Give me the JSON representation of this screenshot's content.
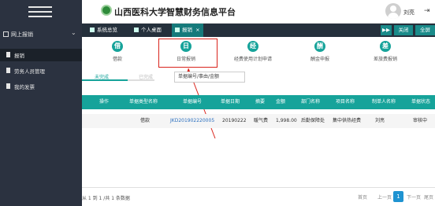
{
  "header": {
    "title": "山西医科大学智慧财务信息平台",
    "username": "刘亮",
    "logout_glyph": "⇥"
  },
  "sidebar": {
    "group_label": "网上报销",
    "items": [
      {
        "label": "报销",
        "active": true
      },
      {
        "label": "劳务人员管理",
        "active": false
      },
      {
        "label": "我的发票",
        "active": false
      }
    ]
  },
  "tabbar": {
    "tabs": [
      {
        "label": "系统总览",
        "active": false
      },
      {
        "label": "个人桌面",
        "active": false
      },
      {
        "label": "报销",
        "active": true
      }
    ],
    "tab_close": "×",
    "nav_next": "▶▶",
    "close_menu": "关闭",
    "fullscreen": "全屏"
  },
  "actions": [
    {
      "glyph": "借",
      "label": "借款"
    },
    {
      "glyph": "日",
      "label": "日常报销"
    },
    {
      "glyph": "经",
      "label": "经费使用计划申请"
    },
    {
      "glyph": "酬",
      "label": "酬金申报"
    },
    {
      "glyph": "差",
      "label": "差旅费报销"
    }
  ],
  "subtabs": {
    "incomplete": "未完成",
    "complete": "已完成"
  },
  "search": {
    "placeholder": "单据编号/事由/金额"
  },
  "table": {
    "headers": [
      "操作",
      "单据类型名称",
      "单据编号",
      "单据日期",
      "摘要",
      "金额",
      "部门名称",
      "项目名称",
      "制单人名称",
      "单据状态"
    ],
    "rows": [
      [
        "",
        "借款",
        "JKD201902220005",
        "20190222",
        "暖气费",
        "1,998.00",
        "后勤保障处",
        "集中供热经费",
        "刘亮",
        "审核中"
      ]
    ]
  },
  "pagination": {
    "info": "从 1 到 1 /共 1 条数据",
    "first": "首页",
    "prev": "上一页",
    "current": "1",
    "next": "下一页",
    "last": "尾页"
  },
  "colors": {
    "accent": "#16a39a",
    "sidebar": "#2b3240",
    "highlight": "#d9231b"
  }
}
